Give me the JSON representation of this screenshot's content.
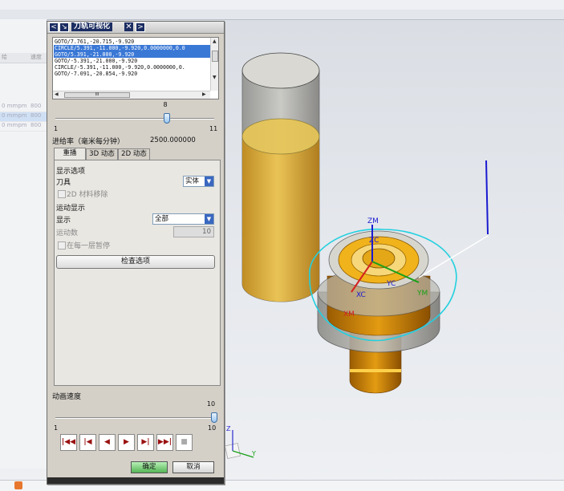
{
  "background_list": {
    "col_a_header": "给",
    "col_b_header": "速度",
    "rows": [
      {
        "a": "0 mmpm",
        "b": "800",
        "selected": false
      },
      {
        "a": "0 mmpm",
        "b": "800",
        "selected": true
      },
      {
        "a": "0 mmpm",
        "b": "800",
        "selected": false
      }
    ]
  },
  "dialog": {
    "title": "刀轨可视化",
    "nav_prev": "<",
    "nav_next": ">",
    "pin_glyph": "↘",
    "close_glyph": "✕",
    "listbox": {
      "lines": [
        {
          "text": "GOTO/7.761,-20.715,-9.920",
          "selected": false
        },
        {
          "text": "CIRCLE/5.391,-11.000,-9.920,0.0000000,0.0",
          "selected": true
        },
        {
          "text": "GOTO/5.391,-21.000,-9.920",
          "selected": true
        },
        {
          "text": "GOTO/-5.391,-21.000,-9.920",
          "selected": false
        },
        {
          "text": "CIRCLE/-5.391,-11.000,-9.920,0.0000000,0.",
          "selected": false
        },
        {
          "text": "GOTO/-7.091,-20.854,-9.920",
          "selected": false
        }
      ],
      "h_thumb_text": "III"
    },
    "step_slider": {
      "value": "8",
      "min": "1",
      "max": "11",
      "fraction": 0.7
    },
    "feed_rate_label": "进给率（毫米每分钟）",
    "feed_rate_value": "2500.000000",
    "tabs": [
      "重播",
      "3D 动态",
      "2D 动态"
    ],
    "display_options_heading": "显示选项",
    "tool_label": "刀具",
    "tool_value": "实体",
    "material_removal_2d": "2D 材料移除",
    "motion_display_heading": "运动显示",
    "display_label": "显示",
    "display_value": "全部",
    "motion_count_label": "运动数",
    "motion_count_value": "10",
    "pause_each_level": "在每一层暂停",
    "check_options_button": "检查选项",
    "animation_speed_label": "动画速度",
    "speed_slider": {
      "value": "10",
      "min": "1",
      "max": "10",
      "fraction": 1.0
    },
    "ok_button": "确定",
    "cancel_button": "取消"
  },
  "scene": {
    "axis_labels": [
      "ZM",
      "ZC",
      "YC",
      "XC",
      "YM",
      "XM"
    ],
    "triad_labels": [
      "Z",
      "Y"
    ]
  },
  "colors": {
    "dialog_title_bg": "#1b2d62",
    "selection_blue": "#3a78d6",
    "toolpath_cyan": "#22d0e0",
    "tool_blue": "#1a1ad0",
    "part_gold": "#e2a618"
  }
}
